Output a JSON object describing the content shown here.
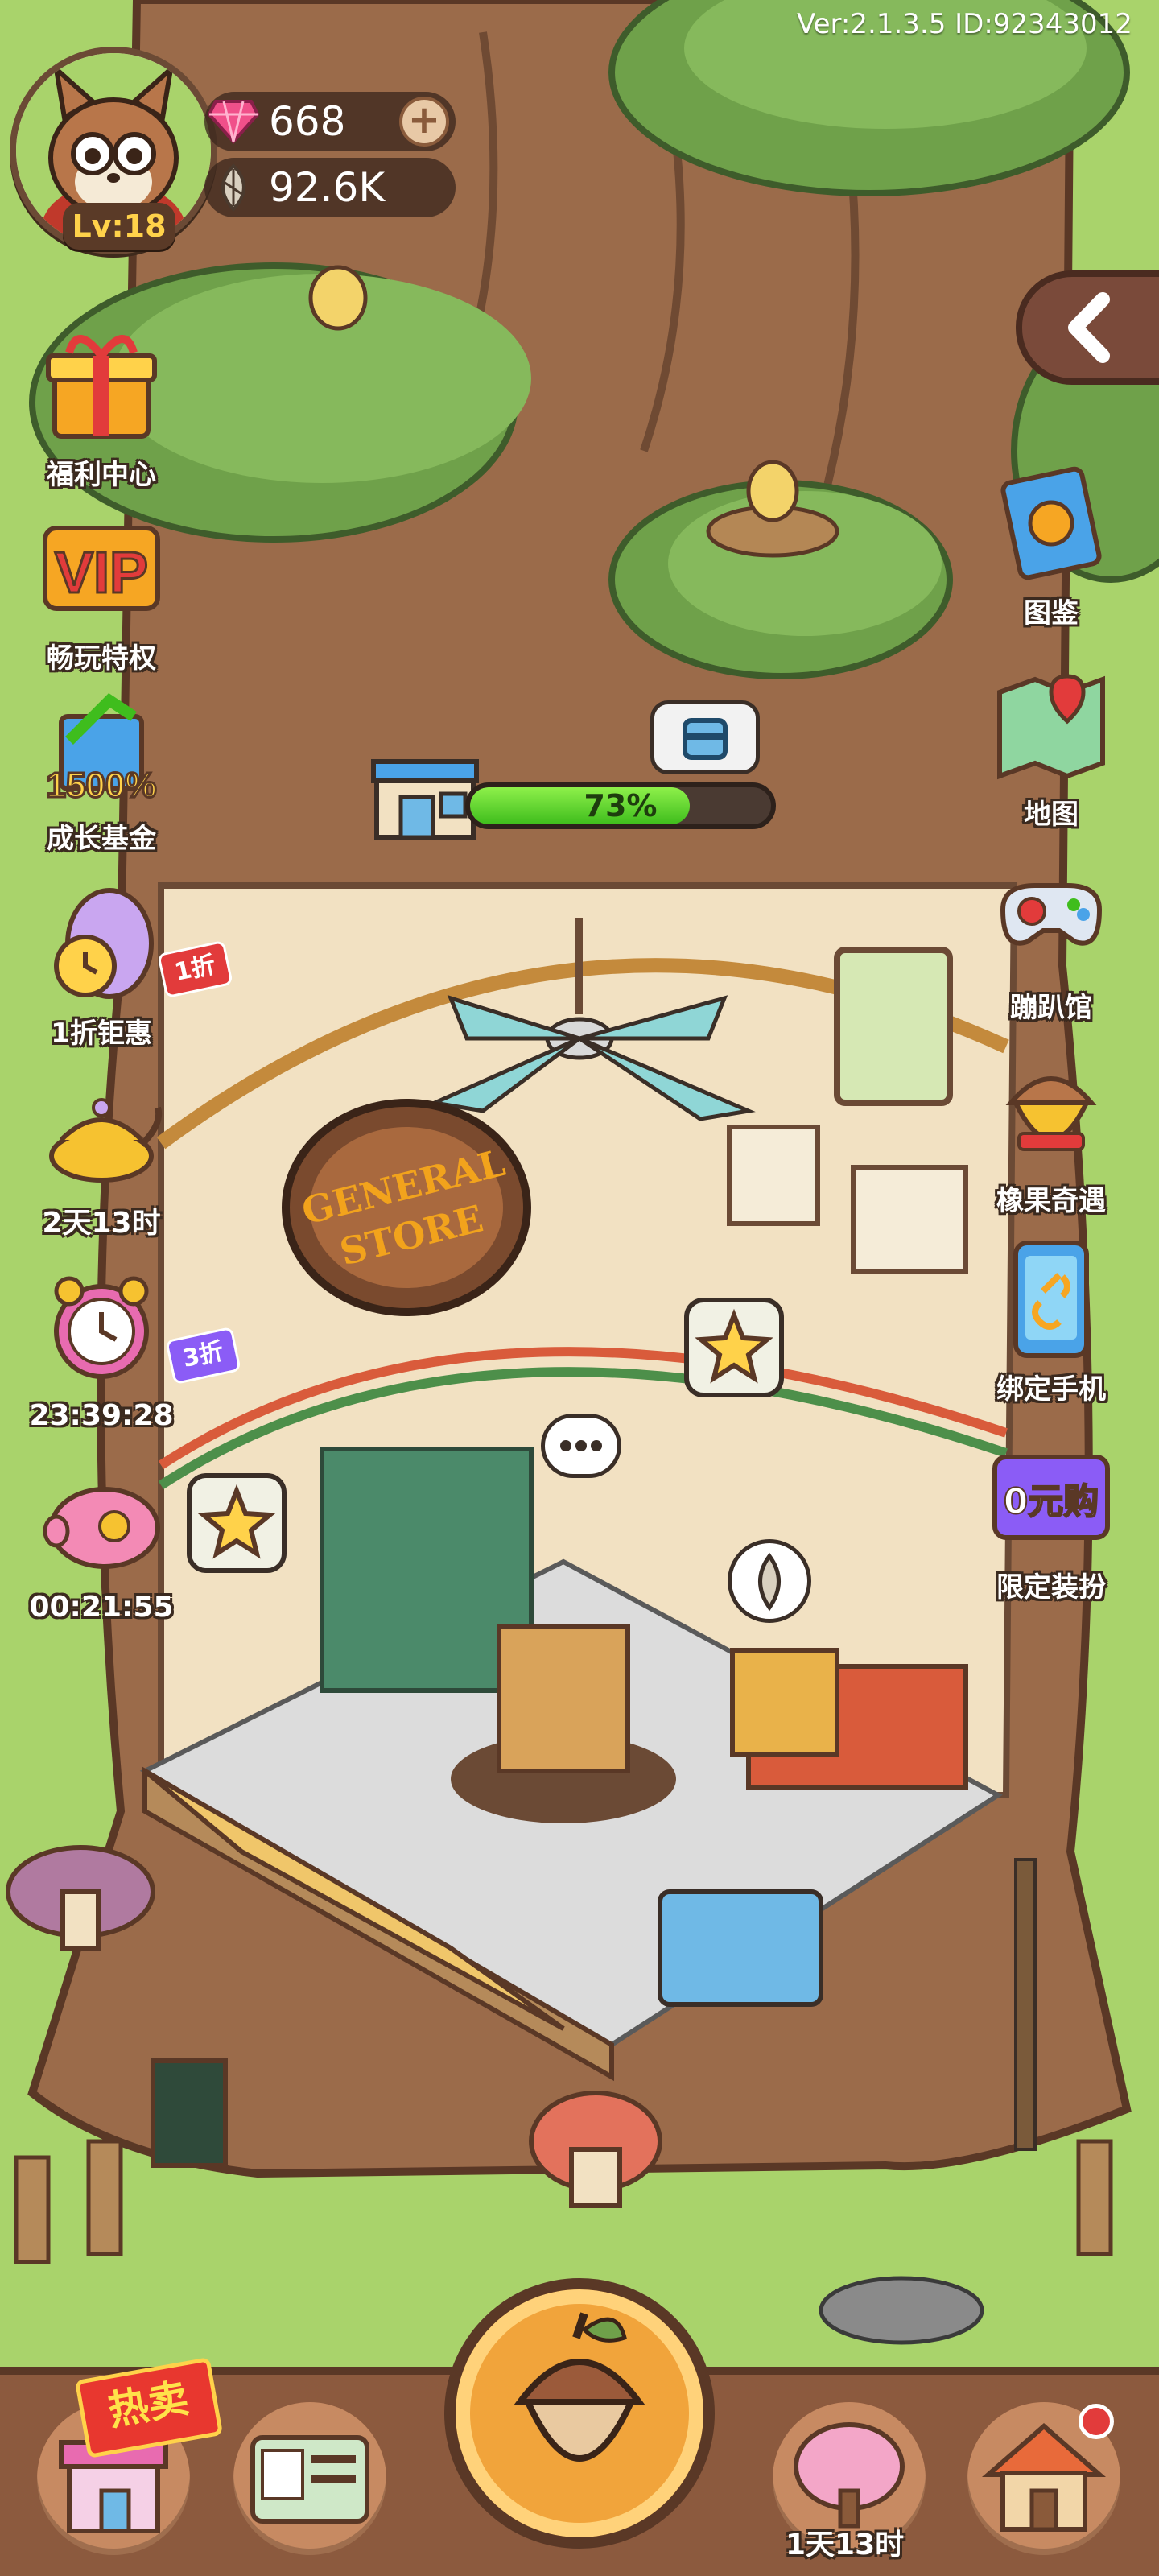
{
  "header": {
    "version_text": "Ver:2.1.3.5 ID:92343012",
    "level": "Lv:18",
    "gems": "668",
    "seeds": "92.6K"
  },
  "left_menu": [
    {
      "label": "福利中心",
      "icon": "gift-box-icon"
    },
    {
      "label": "畅玩特权",
      "icon": "vip-icon"
    },
    {
      "label": "成长基金",
      "icon": "growth-fund-icon",
      "art_text": "1500%"
    },
    {
      "label": "1折钜惠",
      "icon": "egg-clock-icon",
      "badge": "1折"
    },
    {
      "label": "2天13时",
      "icon": "magic-lamp-icon"
    },
    {
      "label": "23:39:28",
      "icon": "alarm-clock-icon",
      "badge": "3折"
    },
    {
      "label": "00:21:55",
      "icon": "piggy-bank-icon"
    }
  ],
  "right_menu": [
    {
      "label": "图鉴",
      "icon": "collection-book-icon"
    },
    {
      "label": "地图",
      "icon": "map-icon"
    },
    {
      "label": "蹦趴馆",
      "icon": "game-controller-icon"
    },
    {
      "label": "橡果奇遇",
      "icon": "acorn-bell-icon"
    },
    {
      "label": "绑定手机",
      "icon": "phone-link-icon"
    },
    {
      "label": "限定装扮",
      "icon": "zero-yuan-icon",
      "art_text": "0元购"
    }
  ],
  "store": {
    "sign_line1": "GENERAL",
    "sign_line2": "STORE",
    "progress_percent": 73,
    "progress_label": "73%"
  },
  "bottom_bar": {
    "hot_badge": "热卖",
    "timer": "1天13时",
    "items": [
      "shop-icon",
      "id-card-icon",
      "acorn-icon",
      "sakura-tree-icon",
      "house-icon"
    ]
  },
  "colors": {
    "grass": "#a9d36b",
    "trunk": "#9b6b4a",
    "progress_green": "#5fd82c",
    "bottom_bar": "#8c5a3e",
    "badge_red": "#e23b3b"
  }
}
